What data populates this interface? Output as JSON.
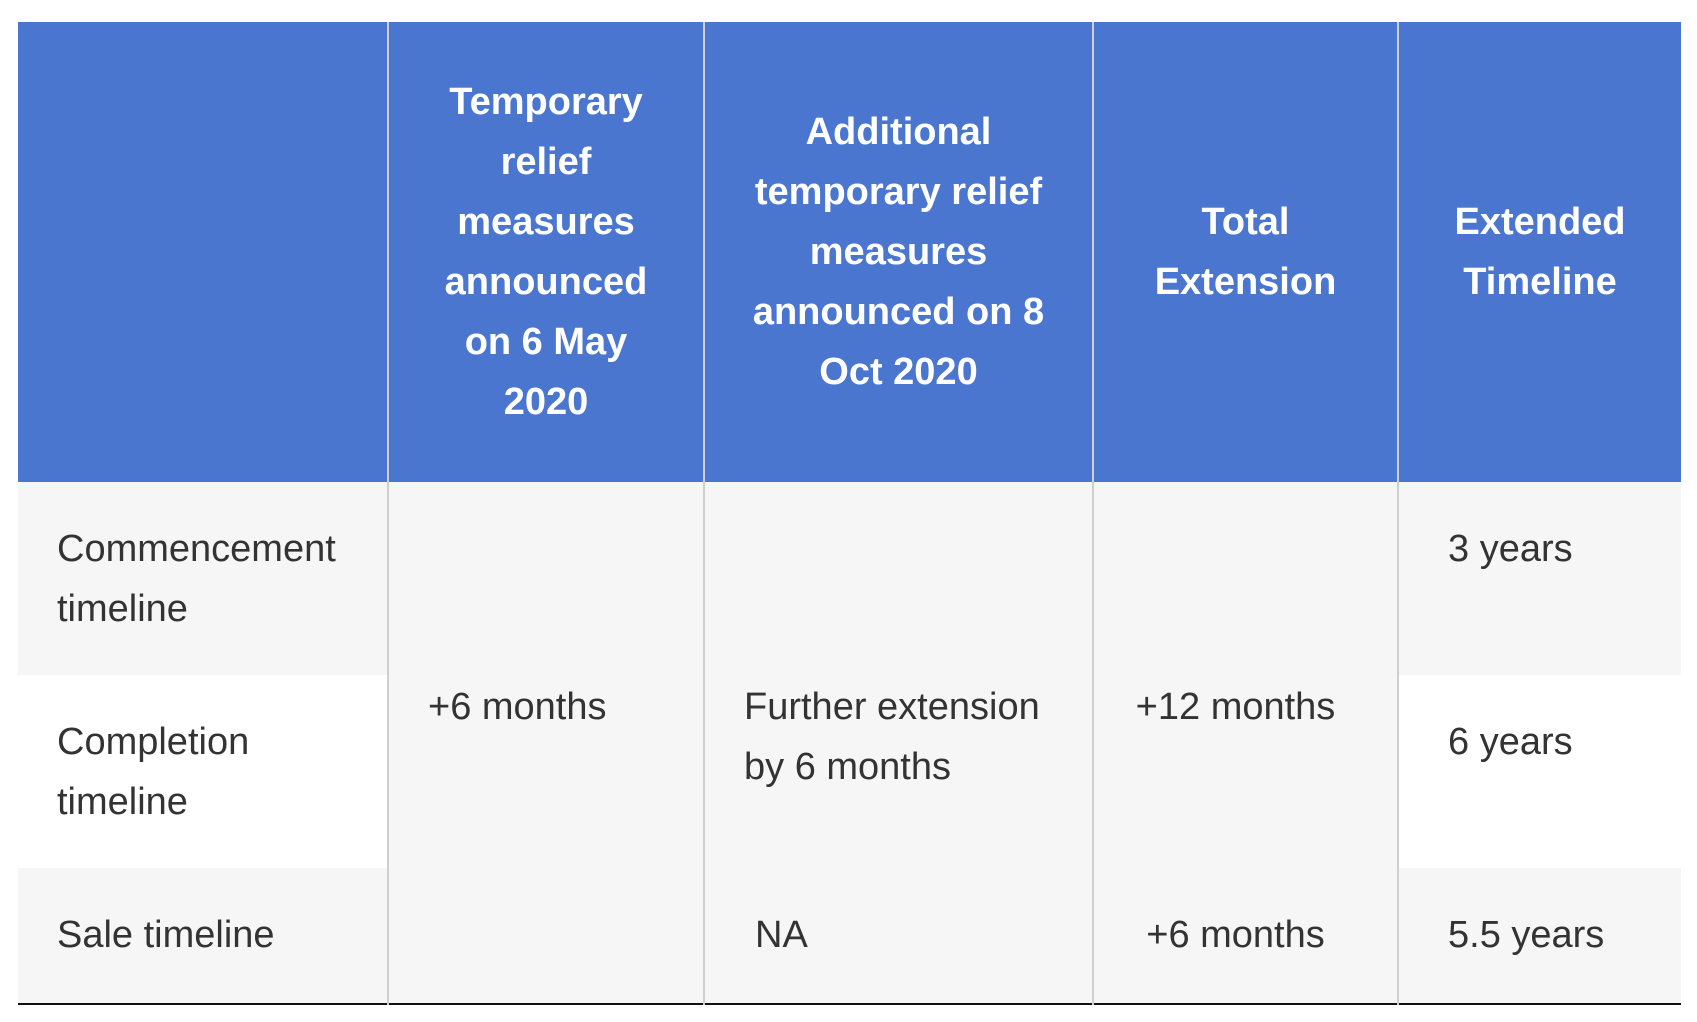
{
  "table": {
    "headers": [
      "",
      "Temporary relief measures announced on 6 May 2020",
      "Additional temporary relief measures announced on 8 Oct 2020",
      "Total Extension",
      "Extended Timeline"
    ],
    "rows": [
      {
        "label": "Commencement timeline",
        "extended": "3 years"
      },
      {
        "label": "Completion timeline",
        "extended": "6 years"
      },
      {
        "label": "Sale timeline",
        "extended": "5.5 years"
      }
    ],
    "merged": {
      "temporary_all_rows": "+6 months",
      "additional_commencement_completion": "Further extension by 6 months",
      "additional_sale": "NA",
      "total_commencement_completion": "+12 months",
      "total_sale": "+6 months"
    }
  },
  "colors": {
    "header_bg": "#4a76d0",
    "row_alt_bg": "#f6f6f6",
    "text": "#333333"
  }
}
